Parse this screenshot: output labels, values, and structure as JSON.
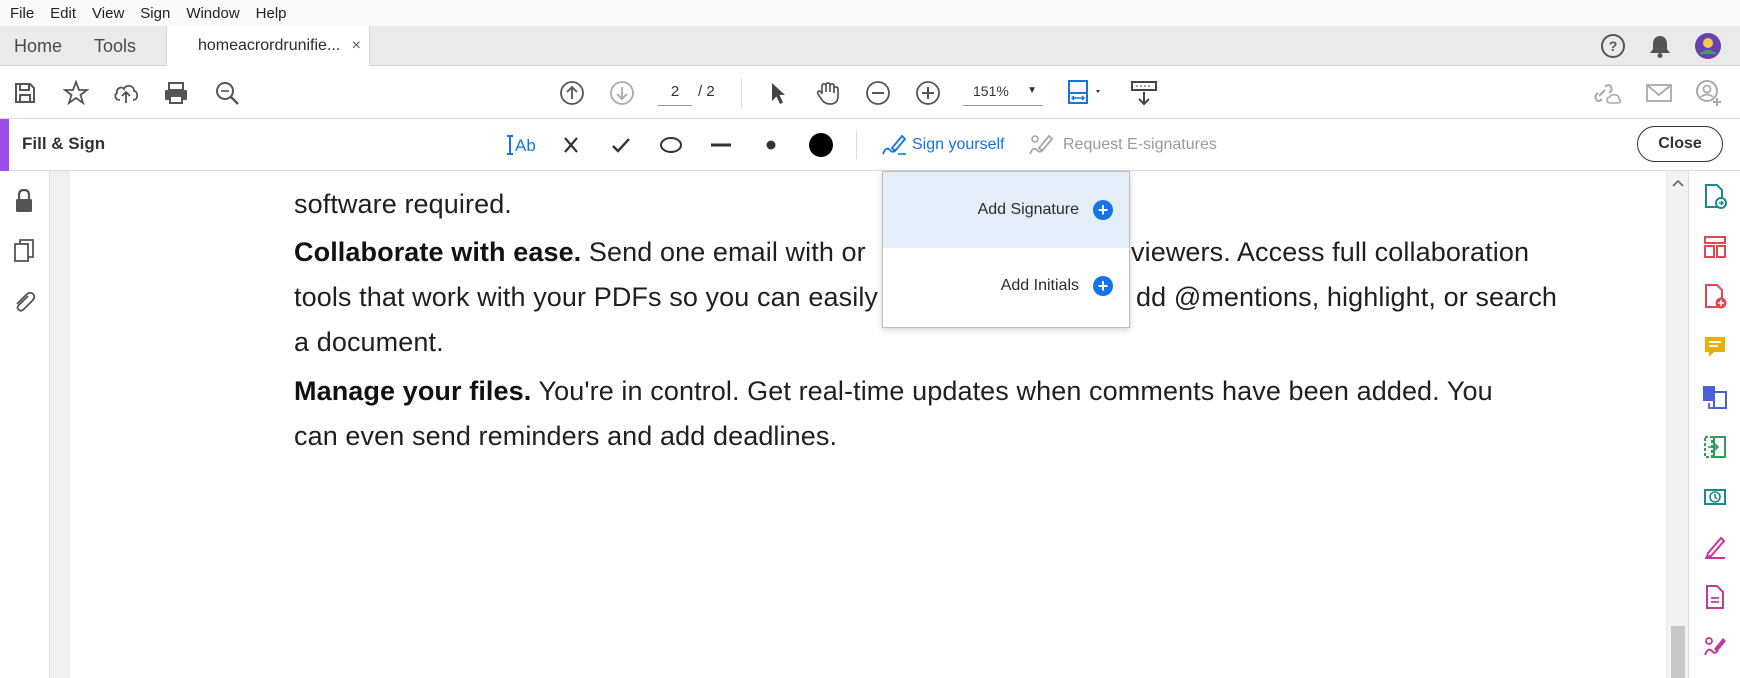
{
  "menubar": {
    "items": [
      "File",
      "Edit",
      "View",
      "Sign",
      "Window",
      "Help"
    ]
  },
  "tabs": {
    "home": "Home",
    "tools": "Tools",
    "document": "homeacrordrunifie...",
    "close_glyph": "×"
  },
  "toolbar": {
    "page_current": "2",
    "page_total": "/ 2",
    "zoom": "151%"
  },
  "fill_sign": {
    "title": "Fill & Sign",
    "text_tool": "Ab",
    "sign_yourself": "Sign yourself",
    "request_esignatures": "Request E-signatures",
    "close": "Close"
  },
  "popup": {
    "add_signature": "Add Signature",
    "add_initials": "Add Initials"
  },
  "document": {
    "line1": "software required.",
    "p2_bold": "Collaborate with ease.",
    "p2_line1_rest": " Send one email with or",
    "p2_line1_right": "viewers. Access full collaboration",
    "p2_line2_left": "tools that work with your PDFs so you can easily",
    "p2_line2_right": "dd @mentions, highlight, or search",
    "p2_line3": "a document.",
    "p3_bold": "Manage your files.",
    "p3_line1_rest": " You're in control. Get real-time updates when comments have been added. You",
    "p3_line2": "can even send reminders and add deadlines."
  },
  "colors": {
    "accent": "#9d4ee8",
    "blue": "#1473e6",
    "popup_selected": "#e3eef9"
  }
}
